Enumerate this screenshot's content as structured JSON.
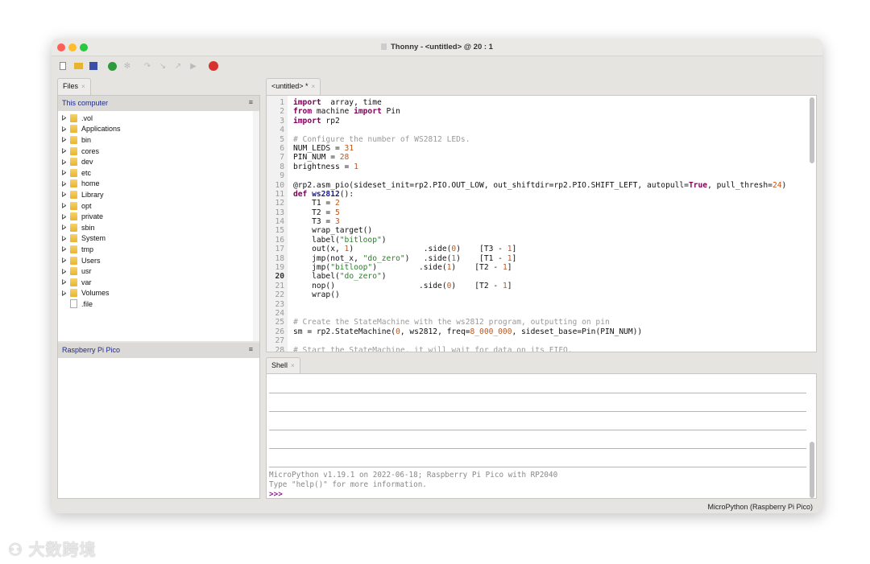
{
  "window": {
    "title": "Thonny  -  <untitled>  @  20 : 1"
  },
  "toolbar": [
    "new-file",
    "open-file",
    "save",
    "run",
    "debug",
    "step-over",
    "step-into",
    "step-out",
    "resume",
    "stop"
  ],
  "files_tab": {
    "label": "Files",
    "close": "×"
  },
  "this_computer": {
    "label": "This computer",
    "menu": "≡",
    "items": [
      {
        "name": ".vol",
        "type": "folder"
      },
      {
        "name": "Applications",
        "type": "folder"
      },
      {
        "name": "bin",
        "type": "folder"
      },
      {
        "name": "cores",
        "type": "folder"
      },
      {
        "name": "dev",
        "type": "folder"
      },
      {
        "name": "etc",
        "type": "folder"
      },
      {
        "name": "home",
        "type": "folder"
      },
      {
        "name": "Library",
        "type": "folder"
      },
      {
        "name": "opt",
        "type": "folder"
      },
      {
        "name": "private",
        "type": "folder"
      },
      {
        "name": "sbin",
        "type": "folder"
      },
      {
        "name": "System",
        "type": "folder"
      },
      {
        "name": "tmp",
        "type": "folder"
      },
      {
        "name": "Users",
        "type": "folder"
      },
      {
        "name": "usr",
        "type": "folder"
      },
      {
        "name": "var",
        "type": "folder"
      },
      {
        "name": "Volumes",
        "type": "folder"
      },
      {
        "name": ".file",
        "type": "file"
      }
    ]
  },
  "pico": {
    "label": "Raspberry Pi Pico",
    "menu": "≡"
  },
  "editor_tab": {
    "label": "<untitled> *",
    "close": "×"
  },
  "code": [
    [
      [
        "k",
        "import"
      ],
      [
        "",
        "  array, time"
      ]
    ],
    [
      [
        "k",
        "from"
      ],
      [
        "",
        " machine "
      ],
      [
        "k",
        "import"
      ],
      [
        "",
        " Pin"
      ]
    ],
    [
      [
        "k",
        "import"
      ],
      [
        "",
        " rp2"
      ]
    ],
    [],
    [
      [
        "c",
        "# Configure the number of WS2812 LEDs."
      ]
    ],
    [
      [
        "",
        "NUM_LEDS = "
      ],
      [
        "n",
        "31"
      ]
    ],
    [
      [
        "",
        "PIN_NUM = "
      ],
      [
        "n",
        "28"
      ]
    ],
    [
      [
        "",
        "brightness = "
      ],
      [
        "n",
        "1"
      ]
    ],
    [],
    [
      [
        "",
        "@rp2.asm_pio(sideset_init=rp2.PIO.OUT_LOW, out_shiftdir=rp2.PIO.SHIFT_LEFT, autopull="
      ],
      [
        "k",
        "True"
      ],
      [
        "",
        ", pull_thresh="
      ],
      [
        "n",
        "24"
      ],
      [
        "",
        ")"
      ]
    ],
    [
      [
        "k",
        "def"
      ],
      [
        "",
        " "
      ],
      [
        "f",
        "ws2812"
      ],
      [
        "",
        "():"
      ]
    ],
    [
      [
        "",
        "    T1 = "
      ],
      [
        "n",
        "2"
      ]
    ],
    [
      [
        "",
        "    T2 = "
      ],
      [
        "n",
        "5"
      ]
    ],
    [
      [
        "",
        "    T3 = "
      ],
      [
        "n",
        "3"
      ]
    ],
    [
      [
        "",
        "    wrap_target()"
      ]
    ],
    [
      [
        "",
        "    label("
      ],
      [
        "s",
        "\"bitloop\""
      ],
      [
        "",
        ")"
      ]
    ],
    [
      [
        "",
        "    out(x, "
      ],
      [
        "n",
        "1"
      ],
      [
        "",
        ")               .side("
      ],
      [
        "n",
        "0"
      ],
      [
        "",
        ")    [T3 - "
      ],
      [
        "n",
        "1"
      ],
      [
        "",
        "]"
      ]
    ],
    [
      [
        "",
        "    jmp(not_x, "
      ],
      [
        "s",
        "\"do_zero\""
      ],
      [
        "",
        ")   .side("
      ],
      [
        "n",
        "1"
      ],
      [
        "",
        ")    [T1 - "
      ],
      [
        "n",
        "1"
      ],
      [
        "",
        "]"
      ]
    ],
    [
      [
        "",
        "    jmp("
      ],
      [
        "s",
        "\"bitloop\""
      ],
      [
        "",
        ")         .side("
      ],
      [
        "n",
        "1"
      ],
      [
        "",
        ")    [T2 - "
      ],
      [
        "n",
        "1"
      ],
      [
        "",
        "]"
      ]
    ],
    [
      [
        "",
        "    label("
      ],
      [
        "s",
        "\"do_zero\""
      ],
      [
        "",
        ")"
      ]
    ],
    [
      [
        "",
        "    nop()                  .side("
      ],
      [
        "n",
        "0"
      ],
      [
        "",
        ")    [T2 - "
      ],
      [
        "n",
        "1"
      ],
      [
        "",
        "]"
      ]
    ],
    [
      [
        "",
        "    wrap()"
      ]
    ],
    [],
    [],
    [
      [
        "c",
        "# Create the StateMachine with the ws2812 program, outputting on pin"
      ]
    ],
    [
      [
        "",
        "sm = rp2.StateMachine("
      ],
      [
        "n",
        "0"
      ],
      [
        "",
        ", ws2812, freq="
      ],
      [
        "n",
        "8_000_000"
      ],
      [
        "",
        ", sideset_base=Pin(PIN_NUM))"
      ]
    ],
    [],
    [
      [
        "c",
        "# Start the StateMachine, it will wait for data on its FIFO."
      ]
    ]
  ],
  "shell_tab": {
    "label": "Shell",
    "close": "×"
  },
  "shell": {
    "banner": "MicroPython v1.19.1 on 2022-06-18; Raspberry Pi Pico with RP2040",
    "help": "Type \"help()\" for more information.",
    "prompt": ">>>"
  },
  "status": {
    "interpreter": "MicroPython (Raspberry Pi Pico)"
  },
  "watermark": "大数跨境",
  "colors": {
    "keyword": "#7f0055",
    "number": "#c0551a",
    "string": "#2a7d2a",
    "comment": "#9a9a9a",
    "panel_header": "#1e2a8c"
  }
}
